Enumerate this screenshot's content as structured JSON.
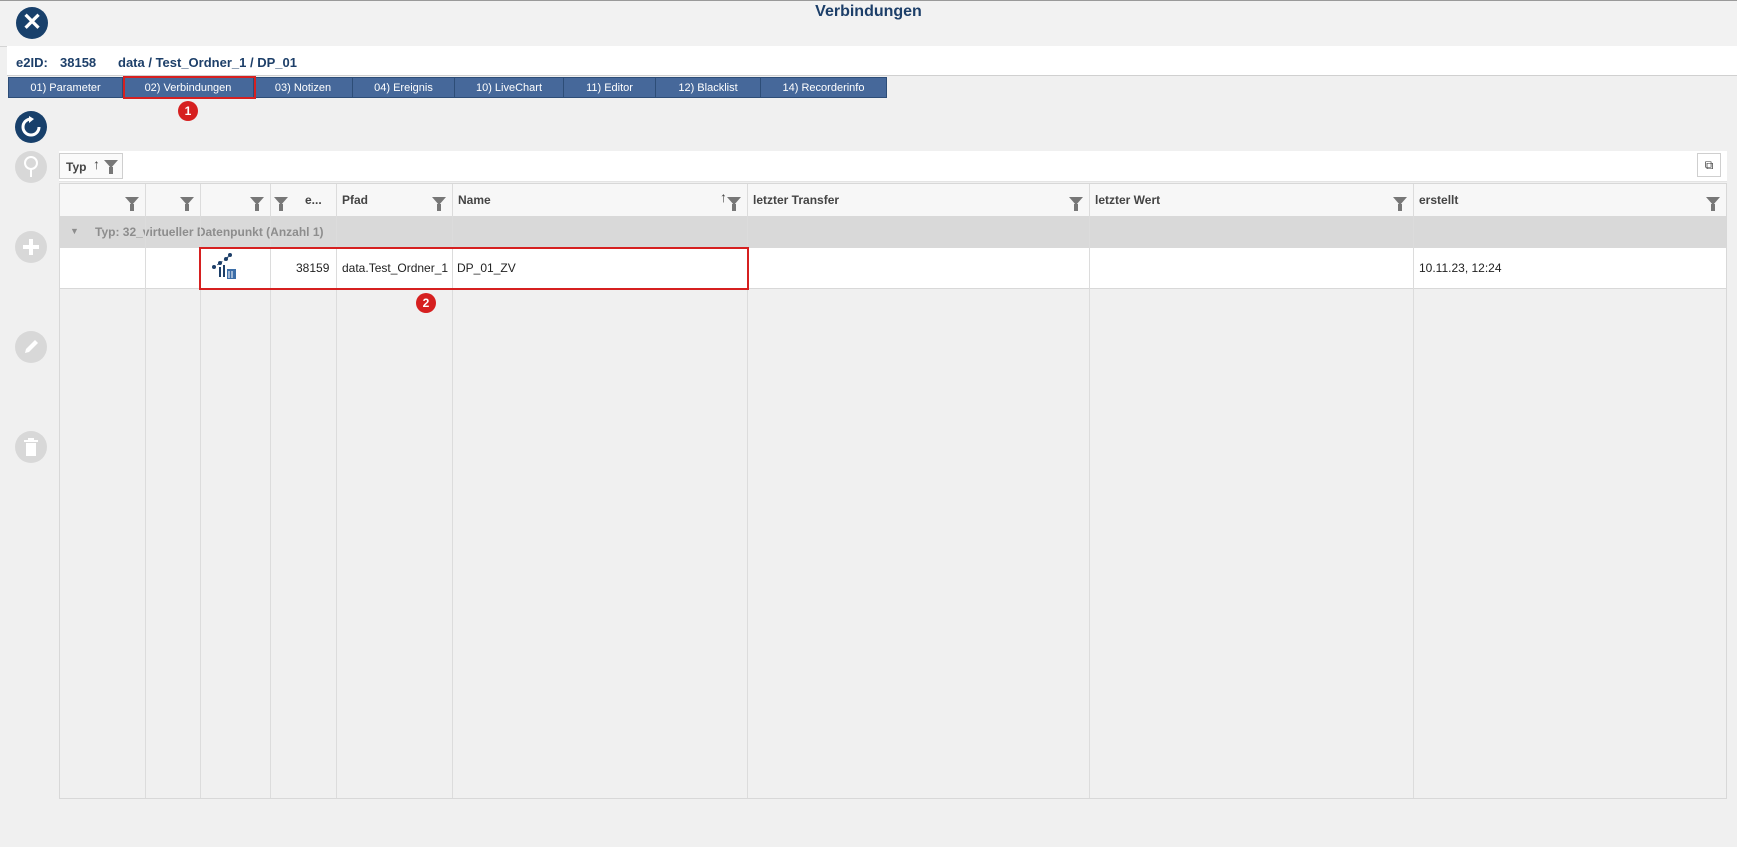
{
  "window": {
    "title": "Verbindungen",
    "close_icon": "close-icon"
  },
  "object": {
    "id_label": "e2ID:",
    "id_value": "38158",
    "path": "data / Test_Ordner_1 / DP_01"
  },
  "tabs": [
    {
      "label": "01) Parameter"
    },
    {
      "label": "02) Verbindungen",
      "active": true
    },
    {
      "label": "03) Notizen"
    },
    {
      "label": "04) Ereignis"
    },
    {
      "label": "10) LiveChart"
    },
    {
      "label": "11) Editor"
    },
    {
      "label": "12) Blacklist"
    },
    {
      "label": "14) Recorderinfo"
    }
  ],
  "annotations": {
    "marker1": "1",
    "marker2": "2",
    "highlight_color": "#d62020"
  },
  "sidebar": {
    "refresh_icon": "refresh-icon",
    "pin_icon": "pin-icon",
    "add_icon": "plus-icon",
    "edit_icon": "pencil-icon",
    "delete_icon": "trash-icon"
  },
  "grouping": {
    "chip_label": "Typ",
    "sort_icon": "sort-up-icon"
  },
  "table": {
    "columns": [
      {
        "label": ""
      },
      {
        "label": ""
      },
      {
        "label": ""
      },
      {
        "label": "e..."
      },
      {
        "label": "Pfad"
      },
      {
        "label": "Name"
      },
      {
        "label": "letzter Transfer"
      },
      {
        "label": "letzter Wert"
      },
      {
        "label": "erstellt"
      }
    ],
    "group_label": "Typ: 32_virtueller Datenpunkt (Anzahl 1)",
    "rows": [
      {
        "type_icon": "virtual-datapoint-icon",
        "e2id": "38159",
        "pfad": "data.Test_Ordner_1",
        "name": "DP_01_ZV",
        "letzter_transfer": "",
        "letzter_wert": "",
        "erstellt": "10.11.23, 12:24"
      }
    ]
  },
  "colors": {
    "brand": "#18406b",
    "tab_bg": "#46689a",
    "group_row": "#d9d9d9"
  }
}
